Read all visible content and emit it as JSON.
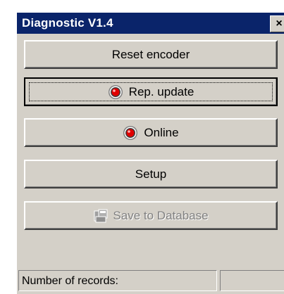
{
  "window": {
    "title": "Diagnostic V1.4",
    "close_glyph": "×"
  },
  "buttons": [
    {
      "label": "Reset encoder"
    },
    {
      "label": "Rep. update",
      "icon": "red-led-icon"
    },
    {
      "label": "Online",
      "icon": "red-led-icon"
    },
    {
      "label": "Setup"
    },
    {
      "label": "Save to Database",
      "icon": "database-save-icon",
      "disabled": true
    }
  ],
  "statusbar": {
    "records_label": "Number of records:",
    "records_value": ""
  },
  "colors": {
    "titlebar": "#0a246a",
    "face": "#d4d0c8",
    "led": "#e00000"
  }
}
